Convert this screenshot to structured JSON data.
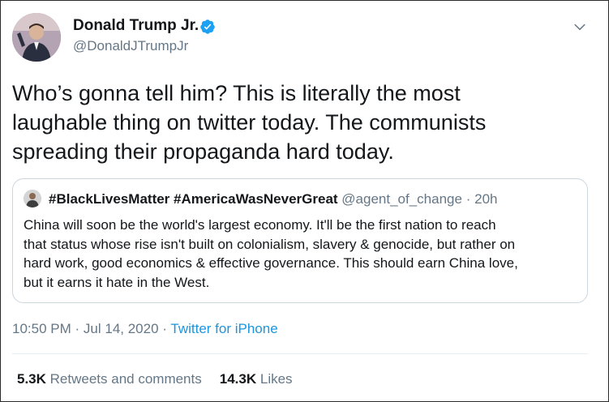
{
  "author": {
    "name": "Donald Trump Jr.",
    "handle": "@DonaldJTrumpJr",
    "verified": true
  },
  "tweet": {
    "text": "Who’s gonna tell him?  This is literally the most\nlaughable thing on twitter today. The communists\nspreading their propaganda hard today."
  },
  "quoted": {
    "name": "#BlackLivesMatter #AmericaWasNeverGreat",
    "handle": "@agent_of_change",
    "separator": "·",
    "time": "20h",
    "text": "China will soon be the world's largest economy. It'll be the first nation to reach\nthat status whose rise isn't built on colonialism, slavery & genocide, but rather on\nhard work, good economics & effective governance. This should earn China love,\nbut it earns it hate in the West."
  },
  "meta": {
    "time": "10:50 PM",
    "sep1": "·",
    "date": "Jul 14, 2020",
    "sep2": "·",
    "source": "Twitter for iPhone"
  },
  "stats": {
    "retweets_count": "5.3K",
    "retweets_label": "Retweets and comments",
    "likes_count": "14.3K",
    "likes_label": "Likes"
  },
  "colors": {
    "accent": "#1b95e0",
    "secondary_text": "#657786",
    "verified_badge": "#1da1f2",
    "border": "#ccd6dd"
  },
  "icons": {
    "verified": "verified-badge-icon",
    "menu": "chevron-down-icon"
  }
}
